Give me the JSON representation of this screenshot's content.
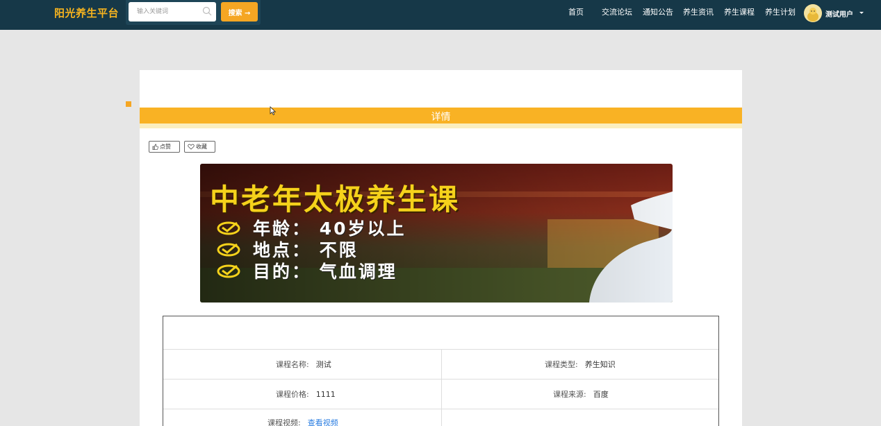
{
  "header": {
    "brand": "阳光养生平台",
    "search": {
      "placeholder": "输入关键词",
      "button_label": "搜索 →"
    },
    "nav": [
      "首页",
      "交流论坛",
      "通知公告",
      "养生资讯",
      "养生课程",
      "养生计划"
    ],
    "user": {
      "name": "测试用户"
    }
  },
  "detail": {
    "title": "详情",
    "like_label": "点赞",
    "favorite_label": "收藏"
  },
  "banner": {
    "heading": "中老年太极养生课",
    "lines": [
      "年龄： 40岁以上",
      "地点： 不限",
      "目的： 气血调理"
    ]
  },
  "info": {
    "course_name_label": "课程名称:",
    "course_name": "测试",
    "course_type_label": "课程类型:",
    "course_type": "养生知识",
    "course_price_label": "课程价格:",
    "course_price": "1111",
    "course_source_label": "课程来源:",
    "course_source": "百度",
    "course_video_label": "课程视频:",
    "course_video_link": "查看视频"
  },
  "colors": {
    "nav_bg": "#163848",
    "accent": "#f9b224",
    "brand": "#f5b31f",
    "link": "#2a7de1"
  }
}
